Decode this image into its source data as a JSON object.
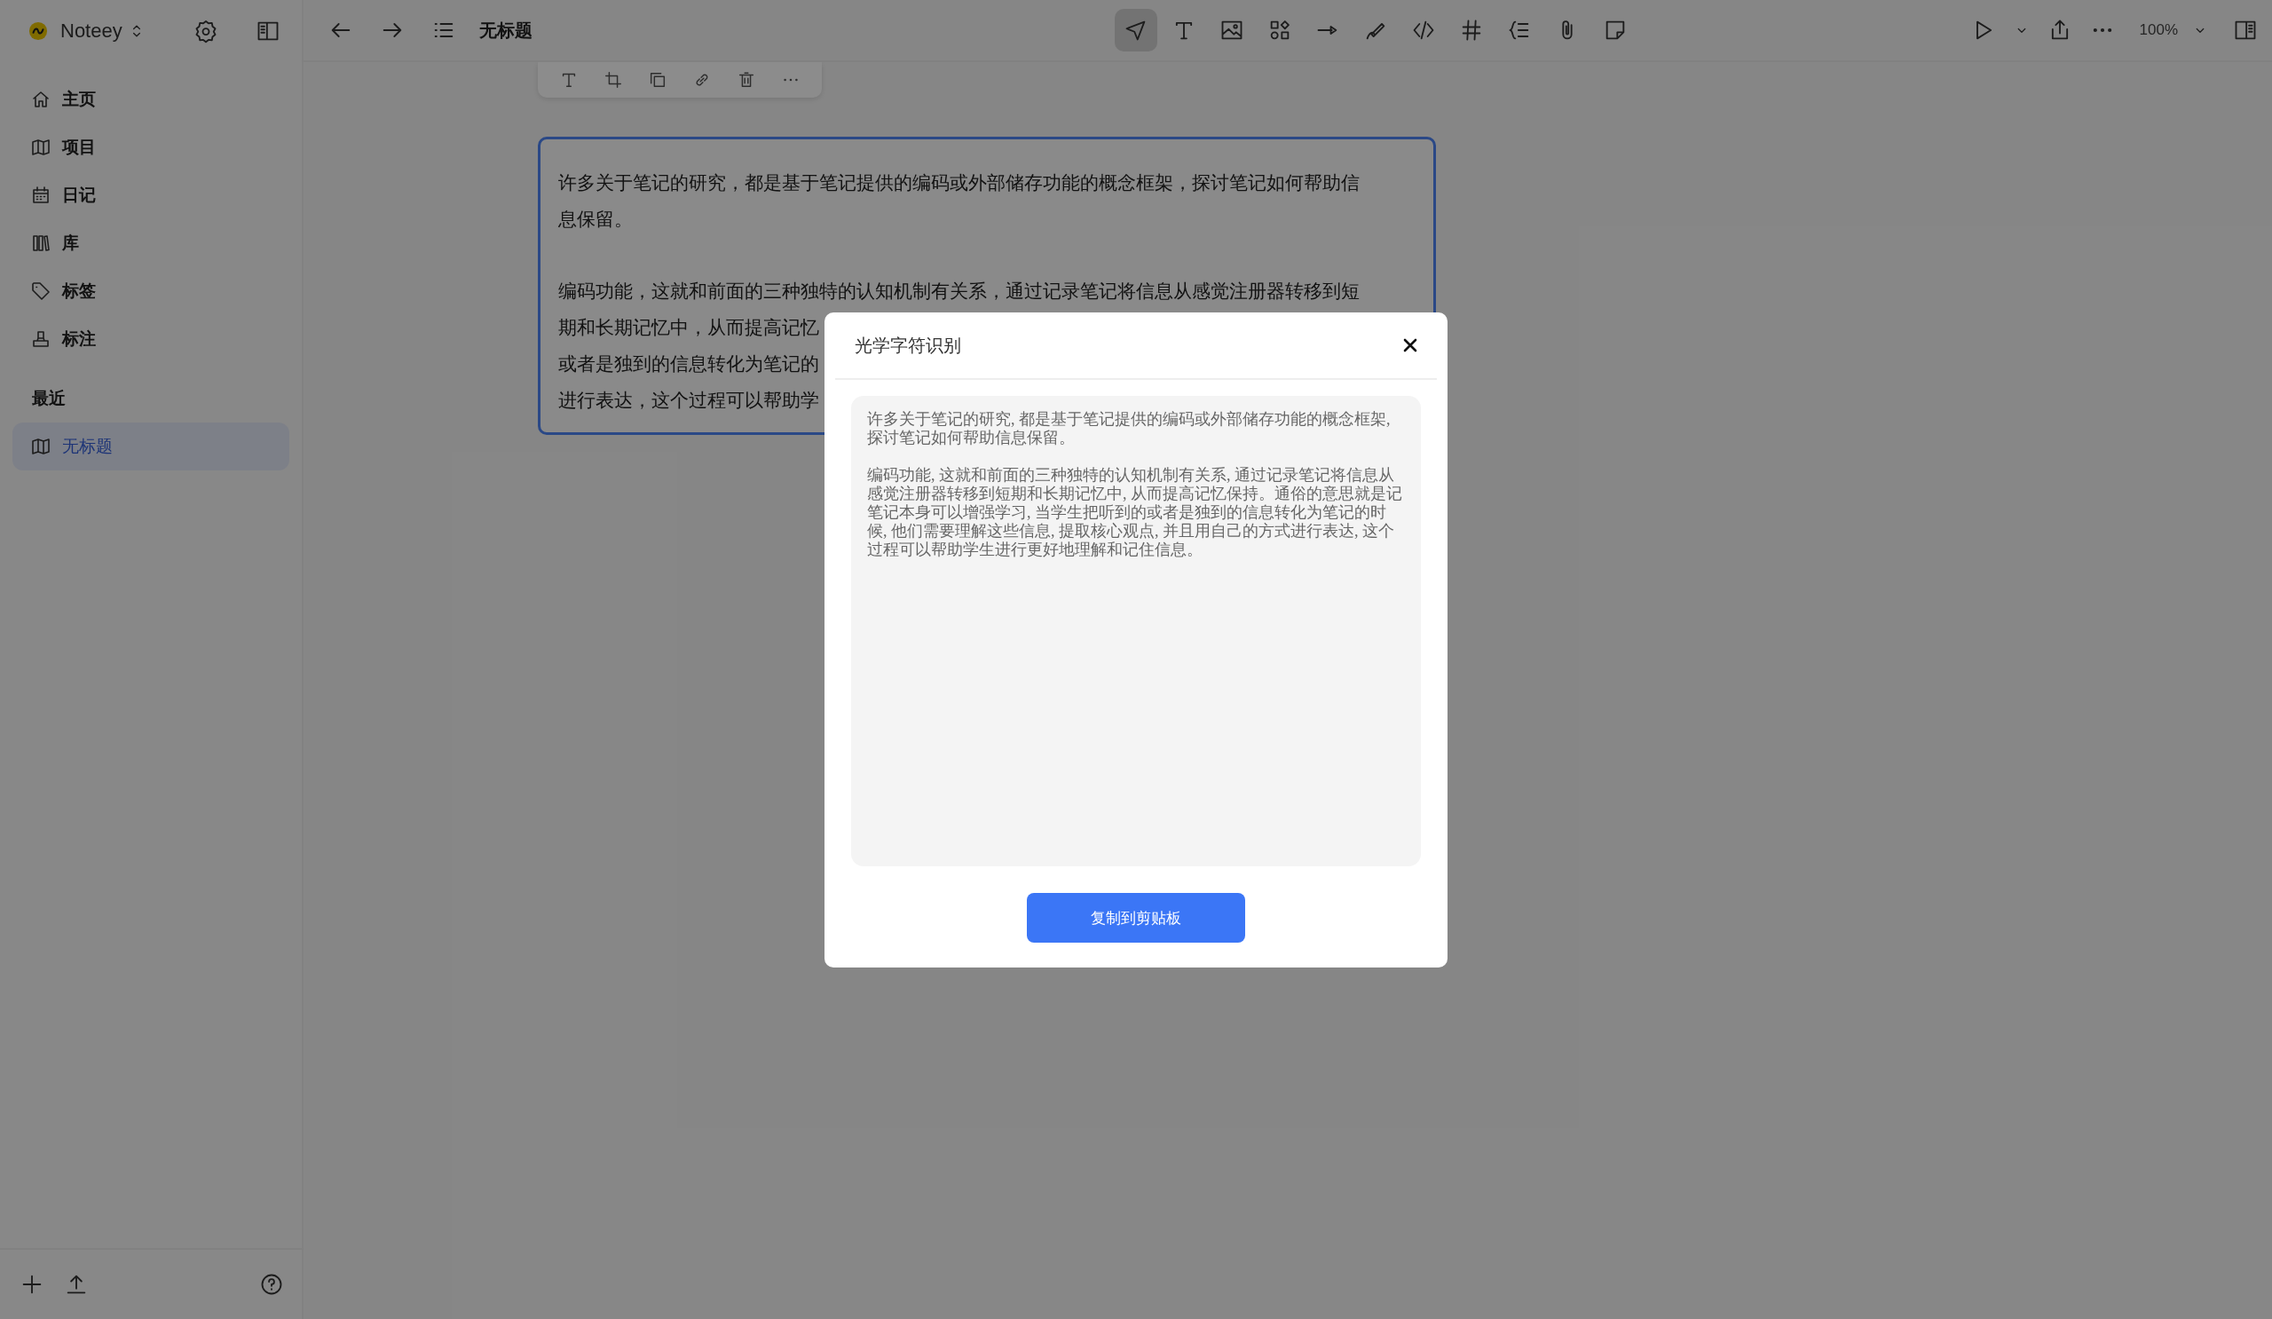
{
  "app": {
    "name": "Noteey"
  },
  "sidebar": {
    "items": [
      {
        "label": "主页",
        "selected": false
      },
      {
        "label": "项目",
        "selected": false
      },
      {
        "label": "日记",
        "selected": false
      },
      {
        "label": "库",
        "selected": false
      },
      {
        "label": "标签",
        "selected": false
      },
      {
        "label": "标注",
        "selected": false
      }
    ],
    "recent_heading": "最近",
    "recent": [
      {
        "label": "无标题",
        "selected": true
      }
    ]
  },
  "topbar": {
    "title": "无标题",
    "tools": [
      {
        "selected": true
      },
      {
        "selected": false
      },
      {
        "selected": false
      },
      {
        "selected": false
      },
      {
        "selected": false
      },
      {
        "selected": false
      },
      {
        "selected": false
      },
      {
        "selected": false
      },
      {
        "selected": false
      },
      {
        "selected": false
      },
      {
        "selected": false
      }
    ],
    "zoom": "100%"
  },
  "note_card": {
    "selected": true,
    "paragraphs": [
      [
        "许多关于笔记的研究，都是基于笔记提供的编码或外部储存功能的概念框架，探讨笔记如何帮助信",
        "息保留。"
      ],
      [
        "编码功能，这就和前面的三种独特的认知机制有关系，通过记录笔记将信息从感觉注册器转移到短",
        "期和长期记忆中，从而提高记忆",
        "或者是独到的信息转化为笔记的",
        "进行表达，这个过程可以帮助学"
      ]
    ]
  },
  "dialog": {
    "title": "光学字符识别",
    "paragraphs": [
      "许多关于笔记的研究, 都是基于笔记提供的编码或外部储存功能的概念框架, 探讨笔记如何帮助信息保留。",
      "编码功能, 这就和前面的三种独特的认知机制有关系, 通过记录笔记将信息从感觉注册器转移到短期和长期记忆中, 从而提高记忆保持。通俗的意思就是记笔记本身可以增强学习, 当学生把听到的或者是独到的信息转化为笔记的时候, 他们需要理解这些信息, 提取核心观点, 并且用自己的方式进行表达, 这个过程可以帮助学生进行更好地理解和记住信息。"
    ],
    "button": "复制到剪贴板"
  }
}
